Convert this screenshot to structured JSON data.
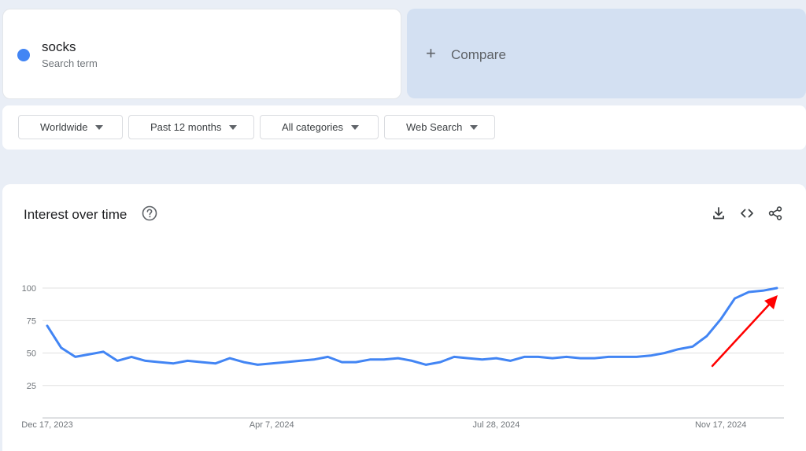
{
  "search_term": {
    "name": "socks",
    "subtitle": "Search term",
    "color": "#4285f4"
  },
  "compare": {
    "plus": "+",
    "label": "Compare"
  },
  "filters": {
    "region": "Worldwide",
    "period": "Past 12 months",
    "category": "All categories",
    "search_type": "Web Search"
  },
  "chart_header": {
    "title": "Interest over time",
    "icons": [
      "help-icon",
      "download-icon",
      "embed-code-icon",
      "share-icon"
    ]
  },
  "annotation": {
    "type": "arrow",
    "color": "#ff0000"
  },
  "chart_data": {
    "type": "line",
    "ylim": [
      0,
      100
    ],
    "yticks": [
      25,
      50,
      75,
      100
    ],
    "xtick_labels": [
      "Dec 17, 2023",
      "Apr 7, 2024",
      "Jul 28, 2024",
      "Nov 17, 2024"
    ],
    "line_color": "#4285f4",
    "grid": true,
    "series": [
      {
        "values": [
          71,
          54,
          47,
          49,
          51,
          44,
          47,
          44,
          43,
          42,
          44,
          43,
          42,
          46,
          43,
          41,
          42,
          43,
          44,
          45,
          47,
          43,
          43,
          45,
          45,
          46,
          44,
          41,
          43,
          47,
          46,
          45,
          46,
          44,
          47,
          47,
          46,
          47,
          46,
          46,
          47,
          47,
          47,
          48,
          50,
          53,
          55,
          63,
          76,
          92,
          97,
          98,
          100
        ]
      }
    ]
  }
}
